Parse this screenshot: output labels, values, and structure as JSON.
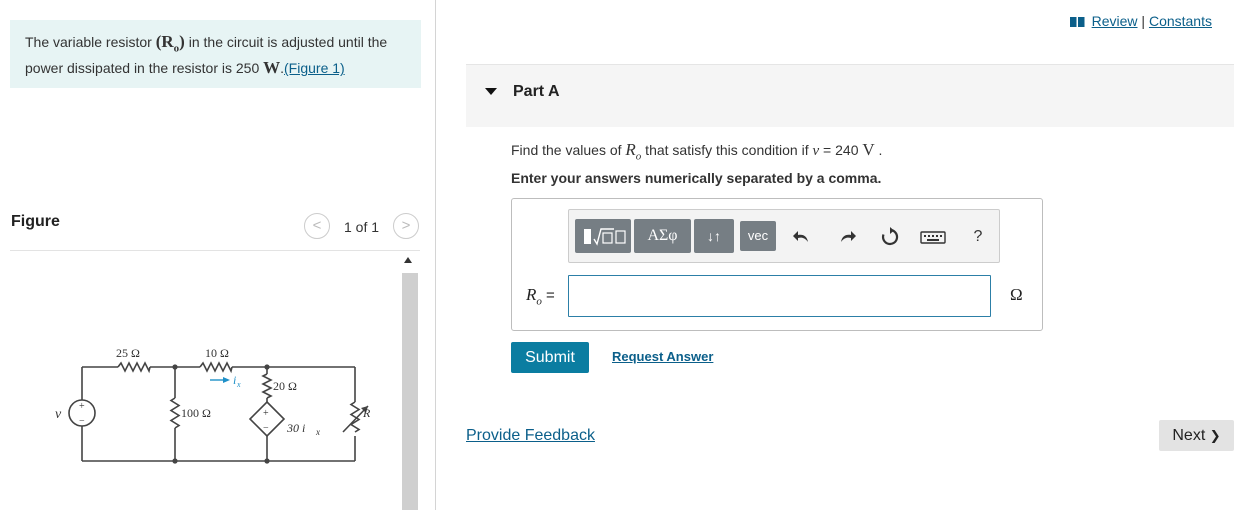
{
  "intro": {
    "text_before": "The variable resistor ",
    "symbol": "(R",
    "symbol_sub": "o",
    "symbol_close": ")",
    "text_middle": " in the circuit is adjusted until the power dissipated in the resistor is 250 ",
    "unit": "W",
    "text_after": ".",
    "figure_link": "(Figure 1)"
  },
  "figure": {
    "label": "Figure",
    "counter": "1 of 1",
    "prev_glyph": "<",
    "next_glyph": ">",
    "circuit": {
      "source_label": "v",
      "r25": "25 Ω",
      "r10": "10 Ω",
      "r100": "100 Ω",
      "r20": "20 Ω",
      "dep_source": "30 i",
      "dep_sub": "x",
      "current": "i",
      "current_sub": "x",
      "ro_label": "R",
      "ro_sub": "o",
      "plus": "+",
      "minus": "−"
    }
  },
  "header": {
    "review_label": "Review",
    "separator": "|",
    "constants_label": "Constants"
  },
  "part": {
    "title": "Part A",
    "question_before": "Find the values of ",
    "question_var": "R",
    "question_var_sub": "o",
    "question_middle": " that satisfy this condition if ",
    "question_v": "v",
    "question_after": " = 240 ",
    "question_unit": "V",
    "question_end": " .",
    "instruction": "Enter your answers numerically separated by a comma."
  },
  "toolbar": {
    "greek_label": "ΑΣφ",
    "sort_label": "↓↑",
    "vec_label": "vec",
    "help_label": "?"
  },
  "answer": {
    "var": "R",
    "var_sub": "o",
    "equals": " =",
    "value": "",
    "unit": "Ω"
  },
  "actions": {
    "submit_label": "Submit",
    "request_answer_label": "Request Answer",
    "provide_feedback_label": "Provide Feedback",
    "next_label": "Next",
    "next_glyph": "❯"
  },
  "colors": {
    "intro_bg": "#e7f4f4",
    "accent": "#0b7da1",
    "link": "#0b5f8a",
    "toolbar_button": "#767e84"
  }
}
